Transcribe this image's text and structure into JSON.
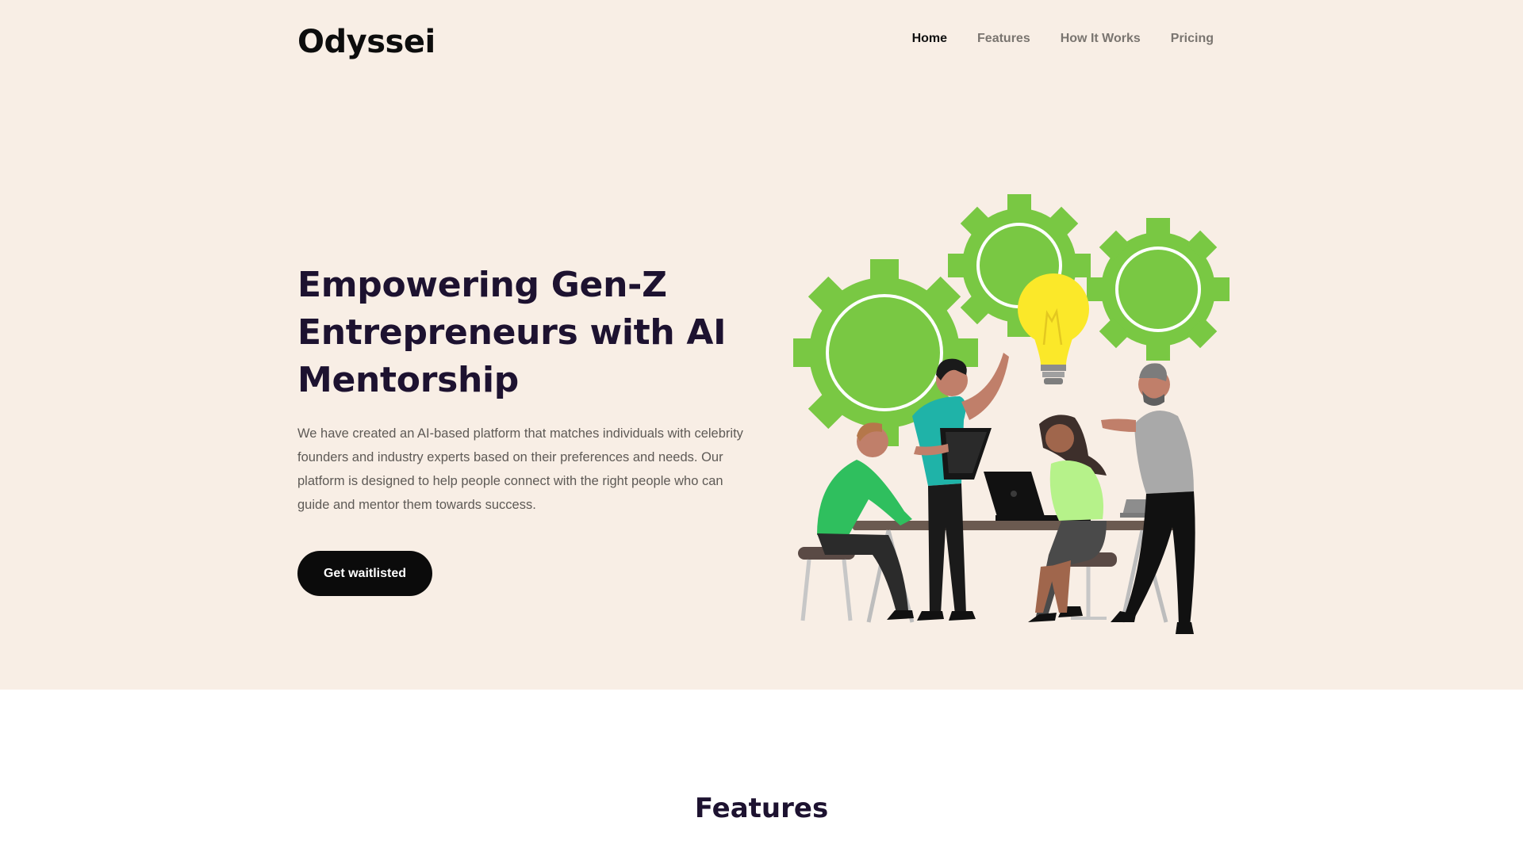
{
  "brand": {
    "logo": "Odyssei"
  },
  "nav": {
    "items": [
      {
        "label": "Home",
        "active": true
      },
      {
        "label": "Features",
        "active": false
      },
      {
        "label": "How It Works",
        "active": false
      },
      {
        "label": "Pricing",
        "active": false
      }
    ]
  },
  "hero": {
    "headline_lines": [
      "Empowering Gen-Z",
      "Entrepreneurs with AI",
      "Mentorship"
    ],
    "description": "We have created an AI-based platform that matches individuals with celebrity founders and industry experts based on their preferences and needs. Our platform is designed to help people connect with the right people who can guide and mentor them towards success.",
    "cta_label": "Get waitlisted",
    "illustration": "team-collaboration-with-gears-and-lightbulb"
  },
  "features": {
    "title": "Features"
  },
  "colors": {
    "hero_bg": "#f8eee5",
    "headline": "#1d1230",
    "gear_green": "#79c843",
    "bulb_yellow": "#fbe829",
    "button_bg": "#0b0b0b"
  }
}
